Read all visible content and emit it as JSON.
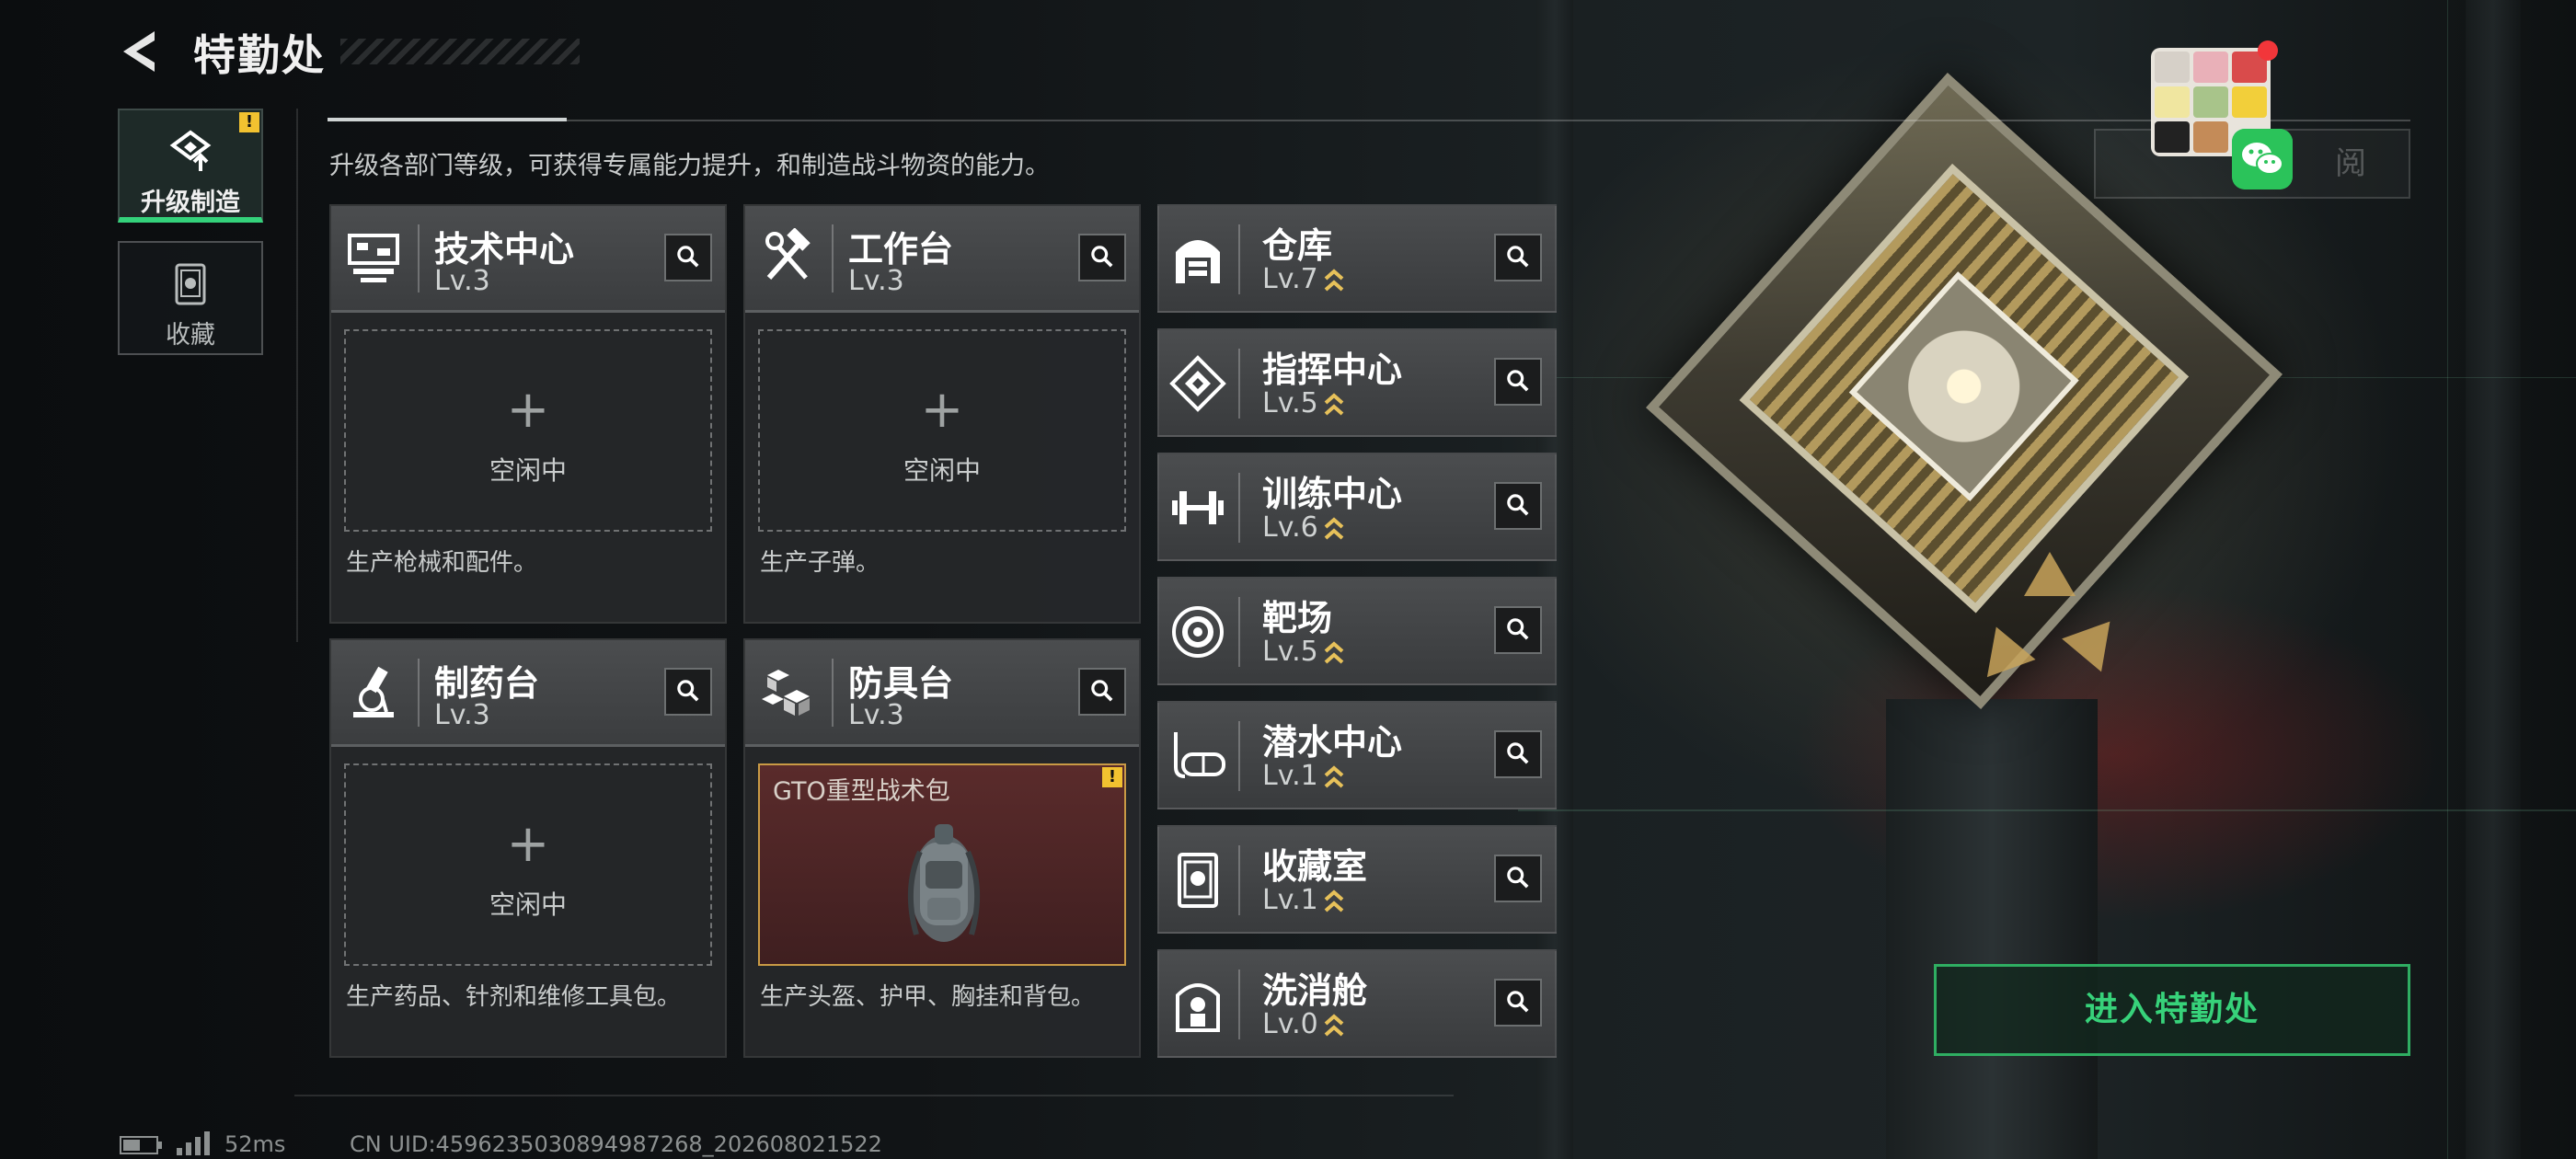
{
  "header": {
    "title": "特勤处",
    "subtitle": "升级各部门等级，可获得专属能力提升，和制造战斗物资的能力。"
  },
  "nav": [
    {
      "label": "升级制造",
      "active": true,
      "icon": "upgrade-icon",
      "badge": "!"
    },
    {
      "label": "收藏",
      "active": false,
      "icon": "collection-icon"
    }
  ],
  "workbenches": [
    {
      "name": "技术中心",
      "level": "Lv.3",
      "icon": "tech-center-icon",
      "slot_text": "空闲中",
      "slot_plus": "+",
      "description": "生产枪械和配件。"
    },
    {
      "name": "工作台",
      "level": "Lv.3",
      "icon": "workbench-tools-icon",
      "slot_text": "空闲中",
      "slot_plus": "+",
      "description": "生产子弹。"
    },
    {
      "name": "制药台",
      "level": "Lv.3",
      "icon": "microscope-icon",
      "slot_text": "空闲中",
      "slot_plus": "+",
      "description": "生产药品、针剂和维修工具包。"
    },
    {
      "name": "防具台",
      "level": "Lv.3",
      "icon": "armor-blocks-icon",
      "item_name": "GTO重型战术包",
      "item_badge": "!",
      "description": "生产头盔、护甲、胸挂和背包。"
    }
  ],
  "facilities": [
    {
      "name": "仓库",
      "level": "Lv.7",
      "icon": "warehouse-icon"
    },
    {
      "name": "指挥中心",
      "level": "Lv.5",
      "icon": "command-center-icon"
    },
    {
      "name": "训练中心",
      "level": "Lv.6",
      "icon": "dumbbell-icon"
    },
    {
      "name": "靶场",
      "level": "Lv.5",
      "icon": "target-icon"
    },
    {
      "name": "潜水中心",
      "level": "Lv.1",
      "icon": "diving-mask-icon"
    },
    {
      "name": "收藏室",
      "level": "Lv.1",
      "icon": "collection-room-icon"
    },
    {
      "name": "洗消舱",
      "level": "Lv.0",
      "icon": "decontamination-icon"
    }
  ],
  "enter_button": "进入特勤处",
  "ghost_button": "阅",
  "status": {
    "ping": "52ms",
    "uid": "CN UID:4596235030894987268_202608021522"
  },
  "colors": {
    "accent": "#34d27b",
    "upgrade_chevron": "#e7c15a",
    "warning": "#f2c230"
  }
}
